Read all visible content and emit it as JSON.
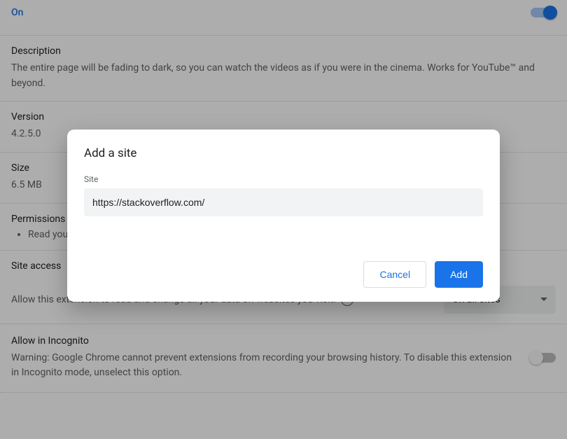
{
  "toprow": {
    "on_label": "On"
  },
  "description": {
    "heading": "Description",
    "body": "The entire page will be fading to dark, so you can watch the videos as if you were in the cinema. Works for YouTube™ and beyond."
  },
  "version": {
    "heading": "Version",
    "value": "4.2.5.0"
  },
  "size": {
    "heading": "Size",
    "value": "6.5 MB"
  },
  "permissions": {
    "heading": "Permissions",
    "items": [
      "Read your browsing history"
    ]
  },
  "site_access": {
    "heading": "Site access",
    "label": "Allow this extension to read and change all your data on websites you visit:",
    "help_glyph": "?",
    "dropdown_value": "On all sites"
  },
  "incognito": {
    "heading": "Allow in Incognito",
    "body": "Warning: Google Chrome cannot prevent extensions from recording your browsing history. To disable this extension in Incognito mode, unselect this option."
  },
  "dialog": {
    "title": "Add a site",
    "field_label": "Site",
    "field_value": "https://stackoverflow.com/",
    "cancel": "Cancel",
    "add": "Add"
  }
}
